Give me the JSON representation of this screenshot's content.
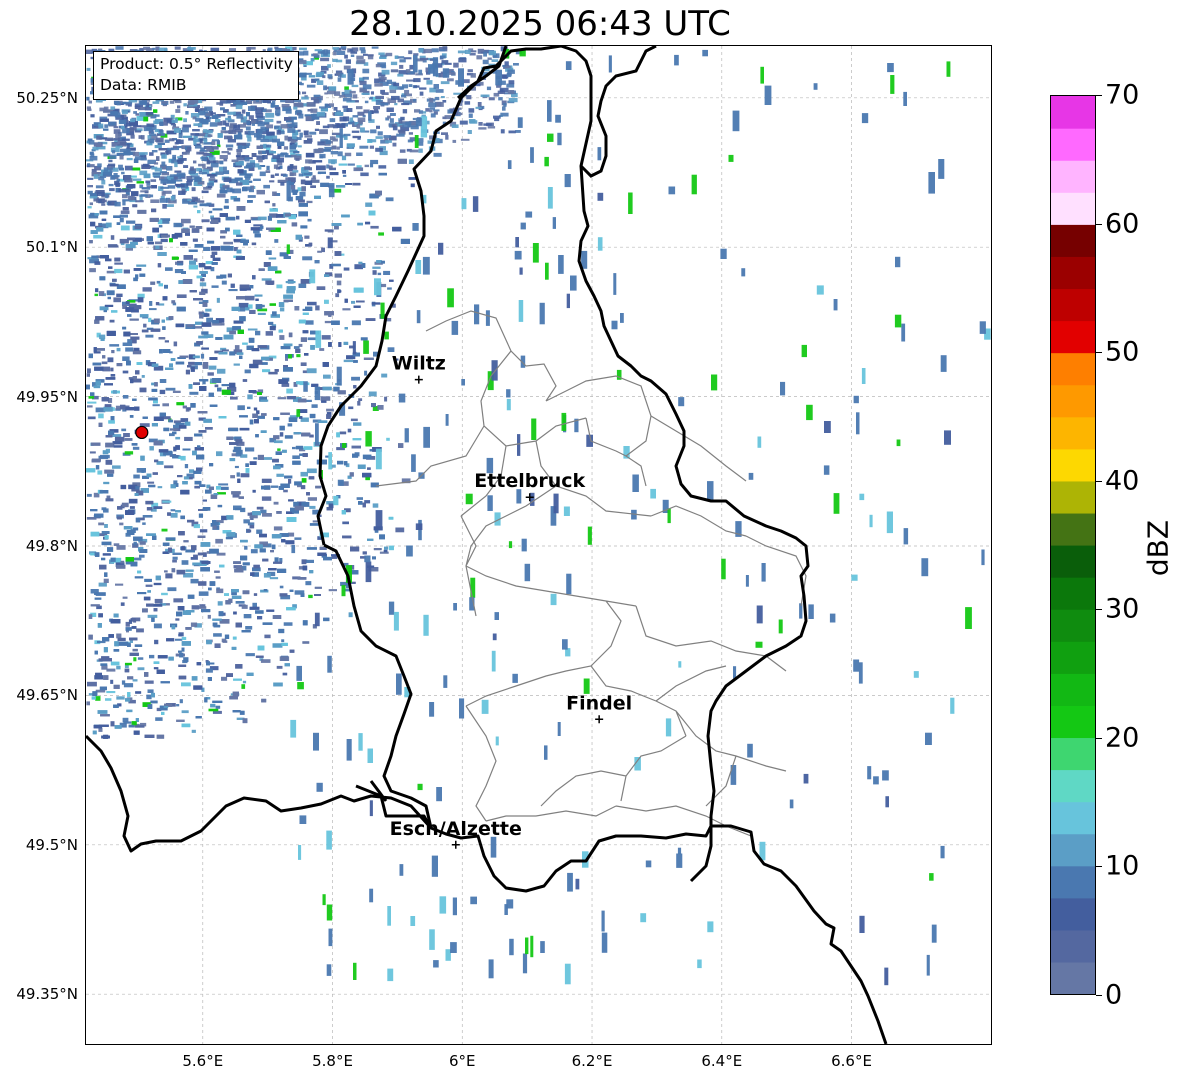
{
  "title": "28.10.2025 06:43 UTC",
  "info_box": {
    "line1": "Product: 0.5° Reflectivity",
    "line2": "Data: RMIB"
  },
  "map": {
    "extent": {
      "lon_min": 5.42,
      "lon_max": 6.815,
      "lat_min": 49.3,
      "lat_max": 50.302
    },
    "lat_labels": [
      "49.35°N",
      "49.5°N",
      "49.65°N",
      "49.8°N",
      "49.95°N",
      "50.1°N",
      "50.25°N"
    ],
    "lat_values": [
      49.35,
      49.5,
      49.65,
      49.8,
      49.95,
      50.1,
      50.25
    ],
    "lon_labels": [
      "5.6°E",
      "5.8°E",
      "6°E",
      "6.2°E",
      "6.4°E",
      "6.6°E"
    ],
    "lon_values": [
      5.6,
      5.8,
      6.0,
      6.2,
      6.4,
      6.6
    ],
    "radar_site": {
      "lon": 5.506,
      "lat": 49.914,
      "color": "#e00000"
    },
    "cities": [
      {
        "name": "Wiltz",
        "lon": 5.933,
        "lat": 49.967
      },
      {
        "name": "Ettelbruck",
        "lon": 6.104,
        "lat": 49.849
      },
      {
        "name": "Findel",
        "lon": 6.211,
        "lat": 49.626
      },
      {
        "name": "Esch/Alzette",
        "lon": 5.99,
        "lat": 49.5
      }
    ]
  },
  "colorbar": {
    "label": "dBZ",
    "min": 0,
    "max": 70,
    "tick_labels": [
      "0",
      "10",
      "20",
      "30",
      "40",
      "50",
      "60",
      "70"
    ],
    "tick_values": [
      0,
      10,
      20,
      30,
      40,
      50,
      60,
      70
    ],
    "colors": [
      "#6577a5",
      "#5468a0",
      "#435e9e",
      "#4a78b0",
      "#5b9ec6",
      "#67c4dc",
      "#5fd8c5",
      "#3ed670",
      "#14c814",
      "#12b814",
      "#10a010",
      "#0f8c0f",
      "#0b780b",
      "#0a5e0a",
      "#447314",
      "#adb405",
      "#fdd801",
      "#fdb500",
      "#fe9900",
      "#fe7f00",
      "#e20000",
      "#be0000",
      "#9b0000",
      "#760000",
      "#ffe0ff",
      "#ffb4ff",
      "#ff69ff",
      "#e736e6"
    ]
  }
}
